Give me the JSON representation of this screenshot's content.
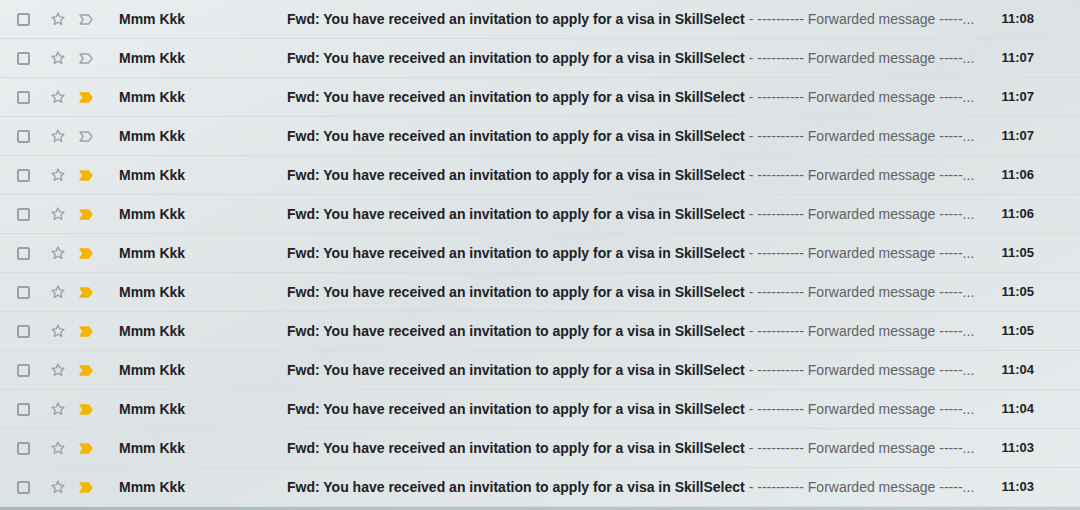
{
  "inbox": {
    "messages": [
      {
        "sender": "Mmm Kkk",
        "subject": "Fwd: You have received an invitation to apply for a visa in SkillSelect",
        "snippet": "- ---------- Forwarded message -----...",
        "time": "11:08",
        "important": false,
        "unread": true,
        "starred": false,
        "checked": false
      },
      {
        "sender": "Mmm Kkk",
        "subject": "Fwd: You have received an invitation to apply for a visa in SkillSelect",
        "snippet": "- ---------- Forwarded message -----...",
        "time": "11:07",
        "important": false,
        "unread": true,
        "starred": false,
        "checked": false
      },
      {
        "sender": "Mmm Kkk",
        "subject": "Fwd: You have received an invitation to apply for a visa in SkillSelect",
        "snippet": "- ---------- Forwarded message -----...",
        "time": "11:07",
        "important": true,
        "unread": true,
        "starred": false,
        "checked": false
      },
      {
        "sender": "Mmm Kkk",
        "subject": "Fwd: You have received an invitation to apply for a visa in SkillSelect",
        "snippet": "- ---------- Forwarded message -----...",
        "time": "11:07",
        "important": false,
        "unread": true,
        "starred": false,
        "checked": false
      },
      {
        "sender": "Mmm Kkk",
        "subject": "Fwd: You have received an invitation to apply for a visa in SkillSelect",
        "snippet": "- ---------- Forwarded message -----...",
        "time": "11:06",
        "important": true,
        "unread": true,
        "starred": false,
        "checked": false
      },
      {
        "sender": "Mmm Kkk",
        "subject": "Fwd: You have received an invitation to apply for a visa in SkillSelect",
        "snippet": "- ---------- Forwarded message -----...",
        "time": "11:06",
        "important": true,
        "unread": true,
        "starred": false,
        "checked": false
      },
      {
        "sender": "Mmm Kkk",
        "subject": "Fwd: You have received an invitation to apply for a visa in SkillSelect",
        "snippet": "- ---------- Forwarded message -----...",
        "time": "11:05",
        "important": true,
        "unread": true,
        "starred": false,
        "checked": false
      },
      {
        "sender": "Mmm Kkk",
        "subject": "Fwd: You have received an invitation to apply for a visa in SkillSelect",
        "snippet": "- ---------- Forwarded message -----...",
        "time": "11:05",
        "important": true,
        "unread": true,
        "starred": false,
        "checked": false
      },
      {
        "sender": "Mmm Kkk",
        "subject": "Fwd: You have received an invitation to apply for a visa in SkillSelect",
        "snippet": "- ---------- Forwarded message -----...",
        "time": "11:05",
        "important": true,
        "unread": true,
        "starred": false,
        "checked": false
      },
      {
        "sender": "Mmm Kkk",
        "subject": "Fwd: You have received an invitation to apply for a visa in SkillSelect",
        "snippet": "- ---------- Forwarded message -----...",
        "time": "11:04",
        "important": true,
        "unread": true,
        "starred": false,
        "checked": false
      },
      {
        "sender": "Mmm Kkk",
        "subject": "Fwd: You have received an invitation to apply for a visa in SkillSelect",
        "snippet": "- ---------- Forwarded message -----...",
        "time": "11:04",
        "important": true,
        "unread": true,
        "starred": false,
        "checked": false
      },
      {
        "sender": "Mmm Kkk",
        "subject": "Fwd: You have received an invitation to apply for a visa in SkillSelect",
        "snippet": "- ---------- Forwarded message -----...",
        "time": "11:03",
        "important": true,
        "unread": true,
        "starred": false,
        "checked": false
      },
      {
        "sender": "Mmm Kkk",
        "subject": "Fwd: You have received an invitation to apply for a visa in SkillSelect",
        "snippet": "- ---------- Forwarded message -----...",
        "time": "11:03",
        "important": true,
        "unread": true,
        "starred": false,
        "checked": false
      }
    ]
  }
}
